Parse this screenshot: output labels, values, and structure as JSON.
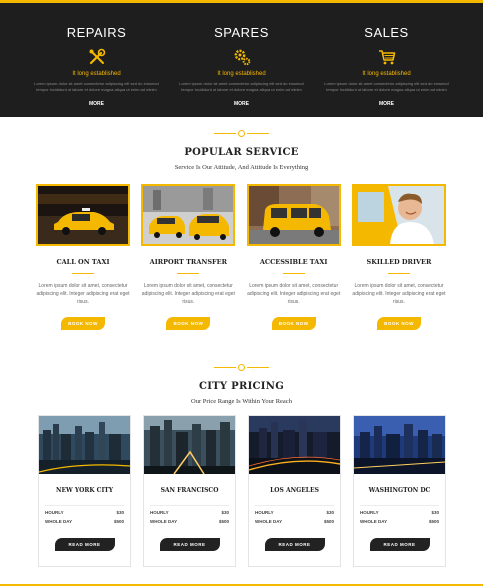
{
  "top": {
    "columns": [
      {
        "title": "REPAIRS",
        "icon": "tools-icon",
        "subtitle": "It long established",
        "text": "Lorem ipsum dolor sit amet consectetur adipiscing elit sed do eiusmod tempor incididunt ut labore et dolore magna aliqua ut enim ad minim",
        "more": "MORE"
      },
      {
        "title": "SPARES",
        "icon": "gears-icon",
        "subtitle": "It long established",
        "text": "Lorem ipsum dolor sit amet consectetur adipiscing elit sed do eiusmod tempor incididunt ut labore et dolore magna aliqua ut enim ad minim",
        "more": "MORE"
      },
      {
        "title": "SALES",
        "icon": "cart-icon",
        "subtitle": "It long established",
        "text": "Lorem ipsum dolor sit amet consectetur adipiscing elit sed do eiusmod tempor incididunt ut labore et dolore magna aliqua ut enim ad minim",
        "more": "MORE"
      }
    ]
  },
  "popular": {
    "title": "POPULAR SERVICE",
    "subtitle": "Service Is Our Attitude, And Attitude Is Everything",
    "items": [
      {
        "name": "CALL ON TAXI",
        "text": "Lorem ipsum dolor sit amet, consectetur adipiscing elit. Integer adipiscing erat eget risus.",
        "button": "BOOK NOW"
      },
      {
        "name": "AIRPORT TRANSFER",
        "text": "Lorem ipsum dolor sit amet, consectetur adipiscing elit. Integer adipiscing erat eget risus.",
        "button": "BOOK NOW"
      },
      {
        "name": "ACCESSIBLE TAXI",
        "text": "Lorem ipsum dolor sit amet, consectetur adipiscing elit. Integer adipiscing erat eget risus.",
        "button": "BOOK NOW"
      },
      {
        "name": "SKILLED DRIVER",
        "text": "Lorem ipsum dolor sit amet, consectetur adipiscing elit. Integer adipiscing erat eget risus.",
        "button": "BOOK NOW"
      }
    ]
  },
  "pricing": {
    "title": "CITY PRICING",
    "subtitle": "Our Price Range Is Within Your Reach",
    "cities": [
      {
        "name": "NEW YORK CITY",
        "hourly_label": "HOURLY",
        "hourly": "$30",
        "day_label": "WHOLE DAY",
        "day": "$500",
        "button": "READ MORE"
      },
      {
        "name": "SAN FRANCISCO",
        "hourly_label": "HOURLY",
        "hourly": "$30",
        "day_label": "WHOLE DAY",
        "day": "$500",
        "button": "READ MORE"
      },
      {
        "name": "LOS ANGELES",
        "hourly_label": "HOURLY",
        "hourly": "$30",
        "day_label": "WHOLE DAY",
        "day": "$500",
        "button": "READ MORE"
      },
      {
        "name": "WASHINGTON DC",
        "hourly_label": "HOURLY",
        "hourly": "$30",
        "day_label": "WHOLE DAY",
        "day": "$500",
        "button": "READ MORE"
      }
    ]
  },
  "colors": {
    "accent": "#f5b800",
    "dark": "#1e1e1e"
  }
}
